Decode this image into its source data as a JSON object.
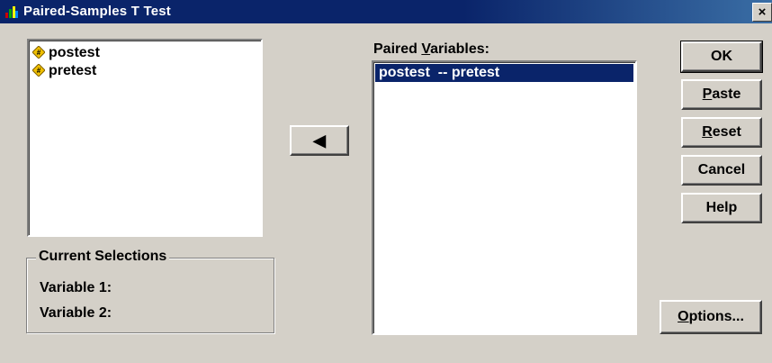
{
  "window": {
    "title": "Paired-Samples T Test",
    "close_glyph": "×"
  },
  "source_list": {
    "items": [
      {
        "label": "postest",
        "icon": "numeric-variable-icon"
      },
      {
        "label": "pretest",
        "icon": "numeric-variable-icon"
      }
    ]
  },
  "move_button": {
    "glyph": "◀"
  },
  "paired": {
    "label_prefix": "Paired ",
    "label_mnemonic": "V",
    "label_suffix": "ariables:",
    "rows": [
      {
        "text": "postest  -- pretest",
        "selected": true
      }
    ]
  },
  "current_selections": {
    "legend": "Current Selections",
    "variable1_label": "Variable 1:",
    "variable2_label": "Variable 2:"
  },
  "buttons": {
    "ok": "OK",
    "paste_mnemonic": "P",
    "paste_rest": "aste",
    "reset_mnemonic": "R",
    "reset_rest": "eset",
    "cancel": "Cancel",
    "help": "Help",
    "options_mnemonic": "O",
    "options_rest": "ptions..."
  },
  "colors": {
    "titlebar": "#0a246a",
    "face": "#d4d0c8",
    "selection": "#0a246a"
  }
}
